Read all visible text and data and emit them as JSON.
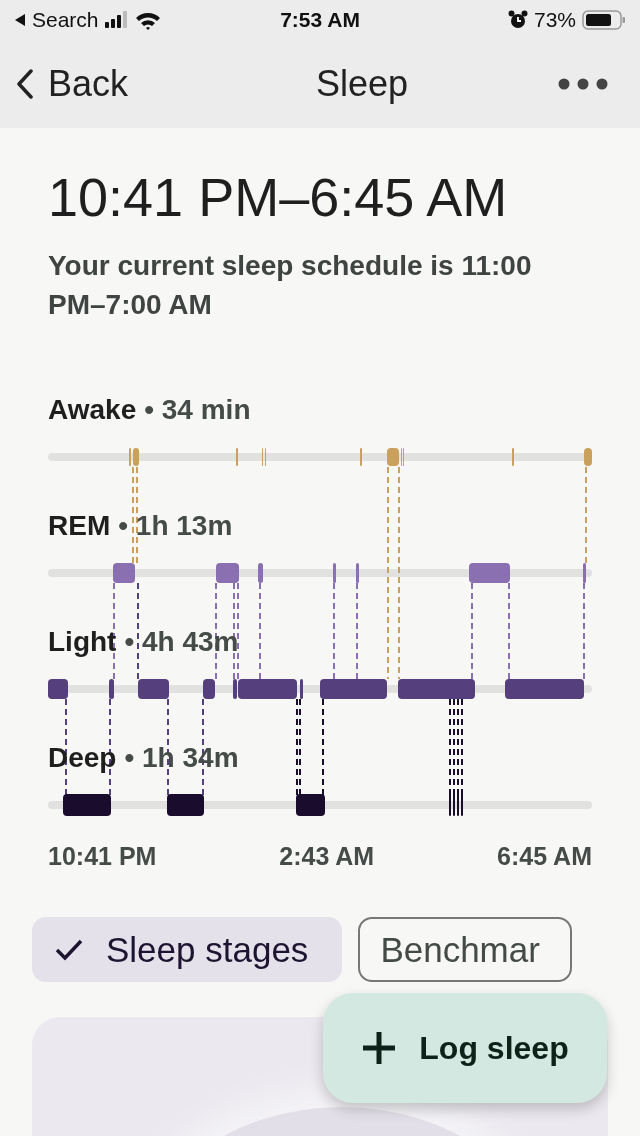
{
  "status_bar": {
    "back_app": "Search",
    "time": "7:53 AM",
    "battery": "73%"
  },
  "nav": {
    "back": "Back",
    "title": "Sleep"
  },
  "summary": {
    "range": "10:41 PM–6:45 AM",
    "schedule": "Your current sleep schedule is 11:00 PM–7:00 AM"
  },
  "stages": [
    {
      "kind": "awake",
      "name": "Awake",
      "duration": "• 34 min"
    },
    {
      "kind": "rem",
      "name": "REM",
      "duration": "• 1h 13m"
    },
    {
      "kind": "light",
      "name": "Light",
      "duration": "• 4h 43m"
    },
    {
      "kind": "deep",
      "name": "Deep",
      "duration": "• 1h 34m"
    }
  ],
  "time_axis": [
    "10:41 PM",
    "2:43 AM",
    "6:45 AM"
  ],
  "chips": [
    {
      "label": "Sleep stages",
      "selected": true
    },
    {
      "label": "Benchmar",
      "selected": false
    }
  ],
  "fab": {
    "label": "Log sleep"
  }
}
